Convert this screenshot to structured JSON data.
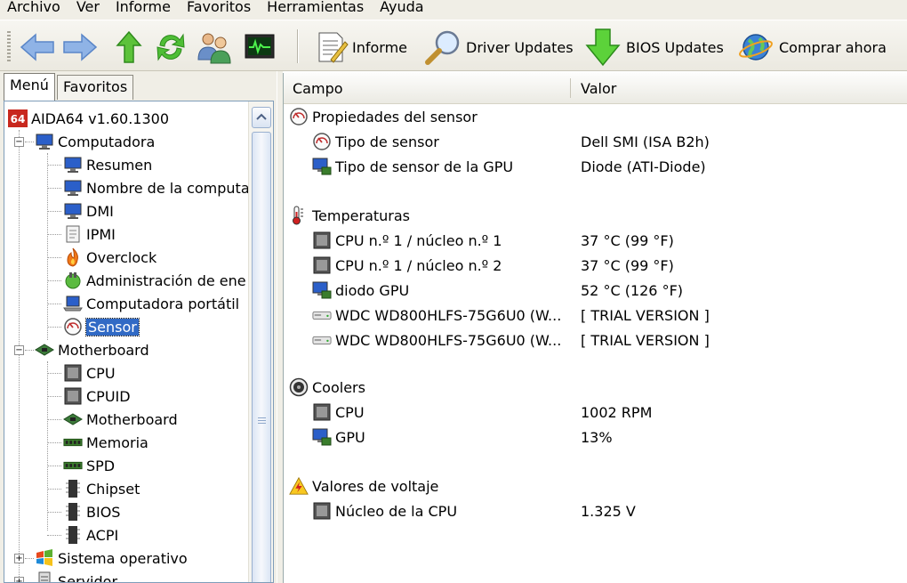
{
  "menu": [
    "Archivo",
    "Ver",
    "Informe",
    "Favoritos",
    "Herramientas",
    "Ayuda"
  ],
  "toolbar": {
    "informe": "Informe",
    "driver_updates": "Driver Updates",
    "bios_updates": "BIOS Updates",
    "comprar": "Comprar ahora"
  },
  "tabs": {
    "menu": "Menú",
    "favoritos": "Favoritos"
  },
  "tree": {
    "root": "AIDA64 v1.60.1300",
    "computadora": "Computadora",
    "computadora_items": [
      "Resumen",
      "Nombre de la computa",
      "DMI",
      "IPMI",
      "Overclock",
      "Administración de ene",
      "Computadora portátil",
      "Sensor"
    ],
    "motherboard": "Motherboard",
    "motherboard_items": [
      "CPU",
      "CPUID",
      "Motherboard",
      "Memoria",
      "SPD",
      "Chipset",
      "BIOS",
      "ACPI"
    ],
    "sistema": "Sistema operativo",
    "servidor": "Servidor"
  },
  "columns": {
    "campo": "Campo",
    "valor": "Valor"
  },
  "sections": {
    "props": {
      "title": "Propiedades del sensor",
      "rows": [
        {
          "field": "Tipo de sensor",
          "value": "Dell SMI  (ISA B2h)"
        },
        {
          "field": "Tipo de sensor de la GPU",
          "value": "Diode  (ATI-Diode)"
        }
      ]
    },
    "temps": {
      "title": "Temperaturas",
      "rows": [
        {
          "field": "CPU n.º 1 / núcleo n.º 1",
          "value": "37 °C  (99 °F)"
        },
        {
          "field": "CPU n.º 1 / núcleo n.º 2",
          "value": "37 °C  (99 °F)"
        },
        {
          "field": "diodo GPU",
          "value": "52 °C  (126 °F)"
        },
        {
          "field": "WDC WD800HLFS-75G6U0 (W...",
          "value": "[ TRIAL VERSION ]"
        },
        {
          "field": "WDC WD800HLFS-75G6U0 (W...",
          "value": "[ TRIAL VERSION ]"
        }
      ]
    },
    "coolers": {
      "title": "Coolers",
      "rows": [
        {
          "field": "CPU",
          "value": "1002 RPM"
        },
        {
          "field": "GPU",
          "value": "13%"
        }
      ]
    },
    "volt": {
      "title": "Valores de voltaje",
      "rows": [
        {
          "field": "Núcleo de la CPU",
          "value": "1.325 V"
        }
      ]
    }
  }
}
